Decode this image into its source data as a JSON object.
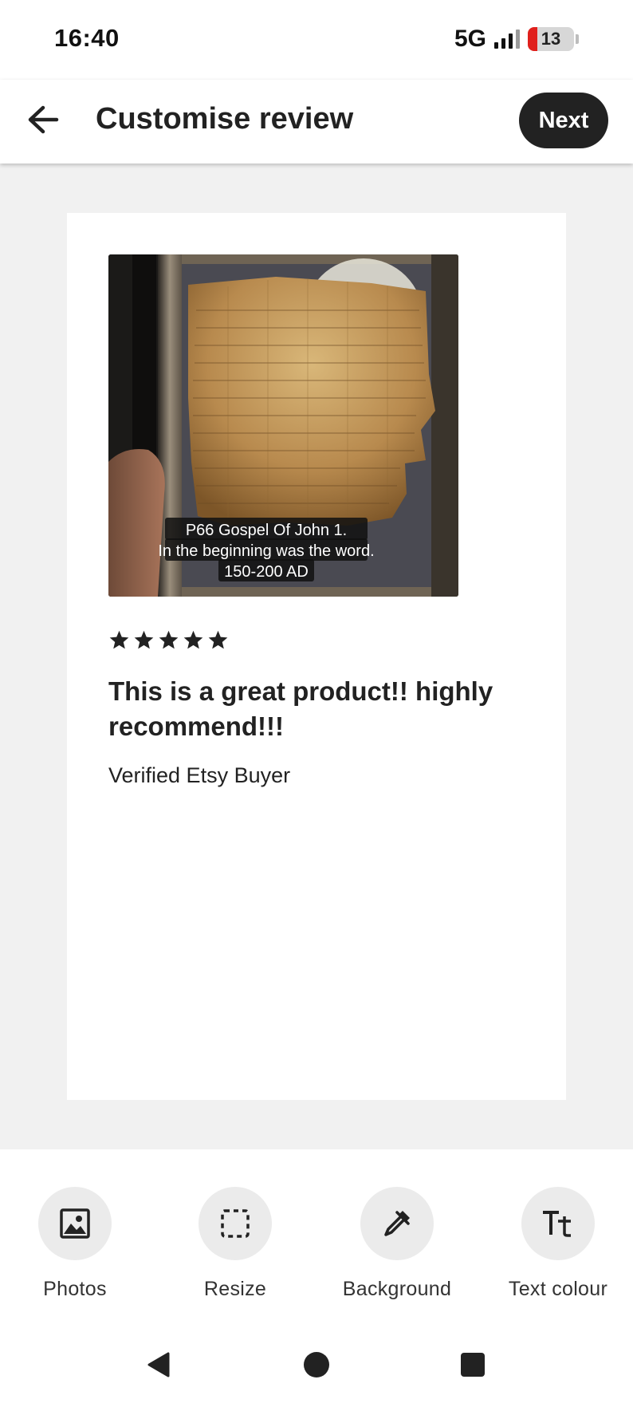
{
  "status_bar": {
    "time": "16:40",
    "network": "5G",
    "battery_percent": "13",
    "battery_color": "#e0201c"
  },
  "app_bar": {
    "title": "Customise review",
    "back_icon": "arrow-left-icon",
    "next_label": "Next"
  },
  "review_card": {
    "photo": {
      "caption_lines": [
        "P66 Gospel Of John 1.",
        "In the beginning was the word.",
        "150-200 AD"
      ]
    },
    "rating": 5,
    "rating_max": 5,
    "text": "This is a great product!! highly recommend!!!",
    "reviewer": "Verified Etsy Buyer"
  },
  "toolbar": {
    "items": [
      {
        "label": "Photos",
        "icon": "image-icon"
      },
      {
        "label": "Resize",
        "icon": "crop-frame-icon"
      },
      {
        "label": "Background",
        "icon": "eyedropper-icon"
      },
      {
        "label": "Text colour",
        "icon": "text-format-icon"
      }
    ]
  },
  "nav_bar": {
    "icons": [
      "back-triangle-icon",
      "home-circle-icon",
      "recents-square-icon"
    ]
  },
  "colors": {
    "primary_button": "#222222",
    "canvas_background": "#f1f1f1",
    "tool_circle": "#ebebeb"
  }
}
